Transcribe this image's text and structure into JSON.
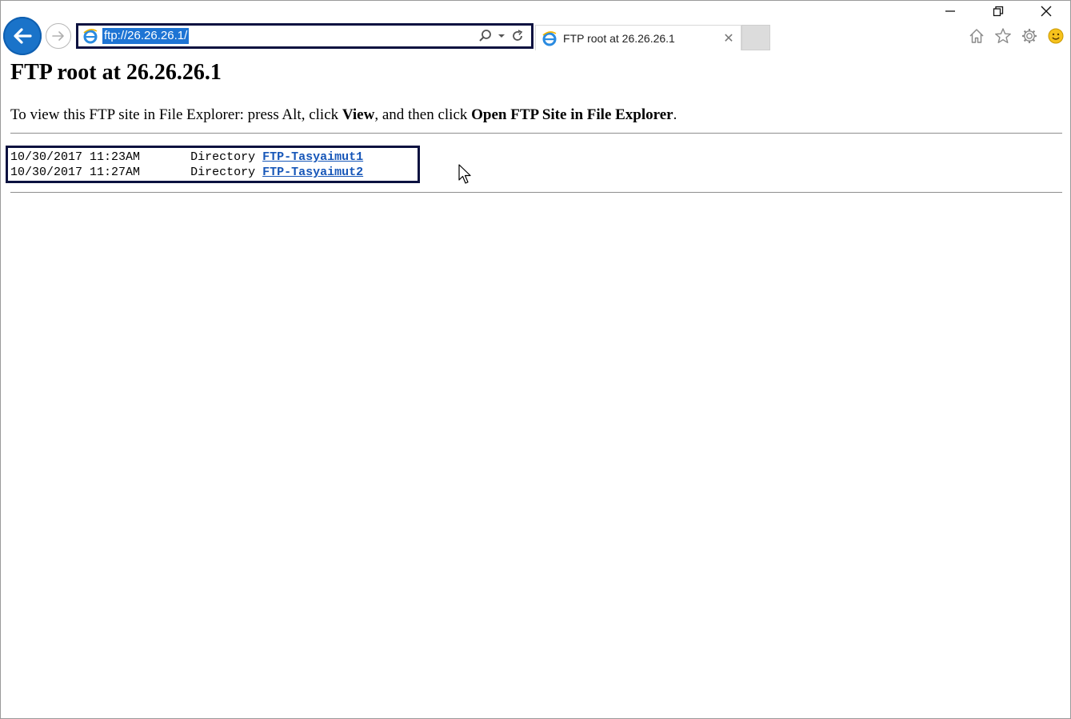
{
  "browser": {
    "address_url": "ftp://26.26.26.1/",
    "tab_title": "FTP root at 26.26.26.1",
    "tab_close": "✕",
    "icons": {
      "back": "back-arrow-icon",
      "forward": "forward-arrow-icon",
      "favicon": "ie-icon",
      "search": "search-icon",
      "dropdown": "dropdown-icon",
      "refresh": "refresh-icon",
      "home": "home-icon",
      "favorites": "star-icon",
      "settings": "gear-icon",
      "feedback": "smiley-icon"
    },
    "colors": {
      "accent": "#1a73c9",
      "highlight": "#0c1240",
      "link": "#1656b8"
    }
  },
  "page": {
    "title": "FTP root at 26.26.26.1",
    "instructions": {
      "prefix": "To view this FTP site in File Explorer: press Alt, click ",
      "view": "View",
      "middle": ", and then click ",
      "open": "Open FTP Site in File Explorer",
      "suffix": "."
    },
    "listing": [
      {
        "date": "10/30/2017",
        "time": "11:23AM",
        "type": "Directory",
        "name": "FTP-Tasyaimut1"
      },
      {
        "date": "10/30/2017",
        "time": "11:27AM",
        "type": "Directory",
        "name": "FTP-Tasyaimut2"
      }
    ]
  }
}
